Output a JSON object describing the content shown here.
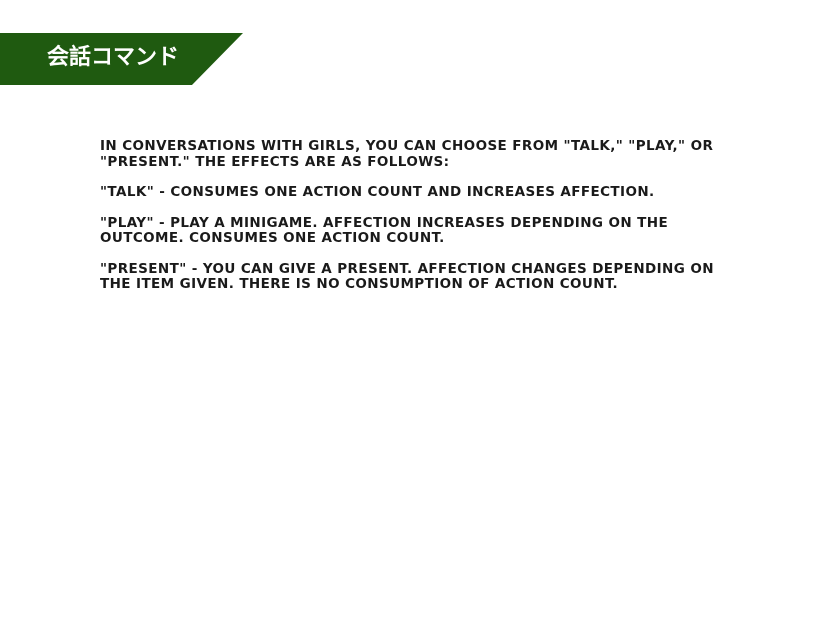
{
  "header": {
    "title": "会話コマンド",
    "accent_color": "#1f5a10"
  },
  "content": {
    "paragraphs": [
      "In conversations with girls, you can choose from \"Talk,\" \"Play,\" or \"Present.\" The effects are as follows:",
      "\"Talk\" - Consumes one action count and increases affection.",
      "\"Play\" - Play a minigame. Affection increases depending on the outcome. Consumes one action count.",
      "\"Present\" - You can give a present. Affection changes depending on the item given. There is no consumption of action count."
    ]
  }
}
